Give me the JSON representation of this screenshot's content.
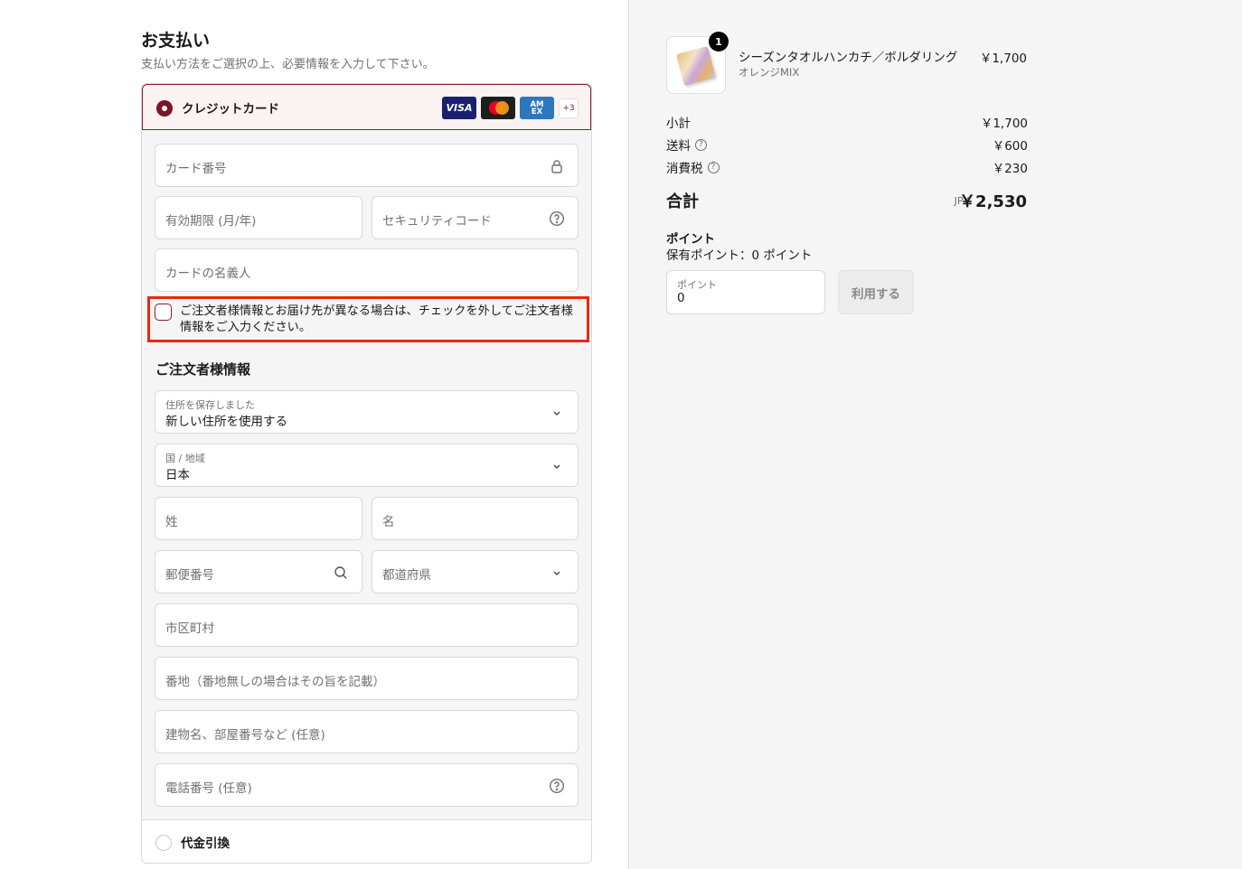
{
  "payment": {
    "title": "お支払い",
    "subtitle": "支払い方法をご選択の上、必要情報を入力して下さい。",
    "credit_card_label": "クレジットカード",
    "card_brands": [
      "VISA",
      "Mastercard",
      "AMEX"
    ],
    "more_brands": "+3",
    "card_number_placeholder": "カード番号",
    "expiry_placeholder": "有効期限 (月/年)",
    "security_code_placeholder": "セキュリティコード",
    "card_name_placeholder": "カードの名義人",
    "billing_checkbox_text": "ご注文者様情報とお届け先が異なる場合は、チェックを外してご注文者様情報をご入力ください。",
    "cod_label": "代金引換"
  },
  "billing": {
    "section_title": "ご注文者様情報",
    "saved_address_label": "住所を保存しました",
    "saved_address_value": "新しい住所を使用する",
    "country_label": "国 / 地域",
    "country_value": "日本",
    "last_name_placeholder": "姓",
    "first_name_placeholder": "名",
    "postal_placeholder": "郵便番号",
    "prefecture_placeholder": "都道府県",
    "city_placeholder": "市区町村",
    "address1_placeholder": "番地（番地無しの場合はその旨を記載）",
    "address2_placeholder": "建物名、部屋番号など (任意)",
    "phone_placeholder": "電話番号 (任意)"
  },
  "summary": {
    "product": {
      "quantity": "1",
      "name": "シーズンタオルハンカチ／ボルダリング",
      "variant": "オレンジMIX",
      "price": "￥1,700"
    },
    "subtotal_label": "小計",
    "subtotal_value": "￥1,700",
    "shipping_label": "送料",
    "shipping_value": "￥600",
    "tax_label": "消費税",
    "tax_value": "￥230",
    "total_label": "合計",
    "total_currency": "JPY",
    "total_value": "￥2,530",
    "points_title": "ポイント",
    "points_held": "保有ポイント：0 ポイント",
    "points_field_label": "ポイント",
    "points_field_value": "0",
    "points_button": "利用する"
  }
}
